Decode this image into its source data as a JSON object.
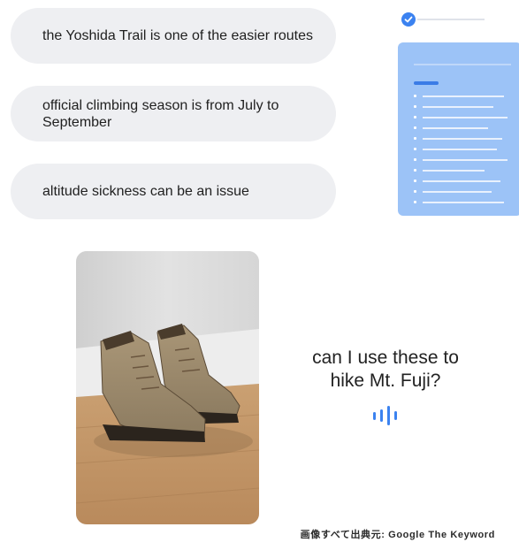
{
  "messages": [
    {
      "text": "the Yoshida Trail is one of the easier routes"
    },
    {
      "text": "official climbing season is from July to September"
    },
    {
      "text": "altitude sickness can be an issue"
    }
  ],
  "query": {
    "line1": "can I use these to",
    "line2": "hike Mt. Fuji?"
  },
  "credit": "画像すべて出典元: Google The Keyword",
  "icons": {
    "check": "check-circle-icon",
    "voice": "voice-wave-icon"
  },
  "colors": {
    "accent": "#3b82f0",
    "bubble": "#eeeff2",
    "doc_card": "#9cc3f7"
  }
}
